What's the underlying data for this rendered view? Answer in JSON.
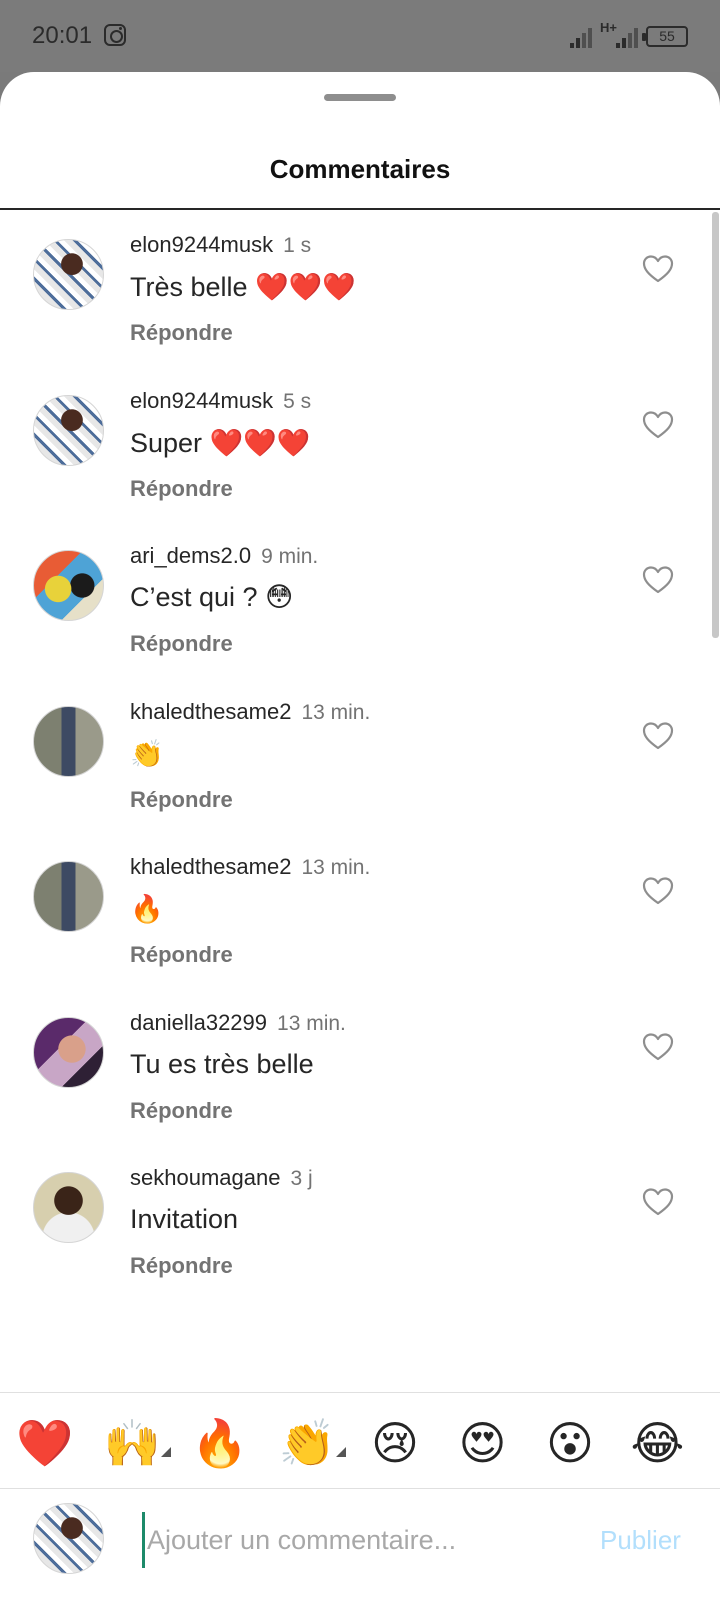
{
  "status_bar": {
    "time": "20:01",
    "network": "H+",
    "battery": "55"
  },
  "sheet": {
    "title": "Commentaires"
  },
  "comments": [
    {
      "user": "elon9244musk",
      "time": "1 s",
      "text": "Très belle ❤️❤️❤️",
      "reply": "Répondre",
      "avatar": "avatar-a"
    },
    {
      "user": "elon9244musk",
      "time": "5 s",
      "text": "Super ❤️❤️❤️",
      "reply": "Répondre",
      "avatar": "avatar-a"
    },
    {
      "user": "ari_dems2.0",
      "time": "9 min.",
      "text": "C’est qui ? 😳",
      "reply": "Répondre",
      "avatar": "avatar-b"
    },
    {
      "user": "khaledthesame2",
      "time": "13 min.",
      "text": "👏",
      "reply": "Répondre",
      "avatar": "avatar-c"
    },
    {
      "user": "khaledthesame2",
      "time": "13 min.",
      "text": "🔥",
      "reply": "Répondre",
      "avatar": "avatar-c"
    },
    {
      "user": "daniella32299",
      "time": "13 min.",
      "text": "Tu es très belle",
      "reply": "Répondre",
      "avatar": "avatar-d"
    },
    {
      "user": "sekhoumagane",
      "time": "3 j",
      "text": "Invitation",
      "reply": "Répondre",
      "avatar": "avatar-e"
    }
  ],
  "reactions": [
    {
      "emoji": "❤️",
      "icon": "heart-emoji",
      "has_more": false
    },
    {
      "emoji": "🙌",
      "icon": "raising-hands-emoji",
      "has_more": true
    },
    {
      "emoji": "🔥",
      "icon": "fire-emoji",
      "has_more": false
    },
    {
      "emoji": "👏",
      "icon": "clapping-hands-emoji",
      "has_more": true
    },
    {
      "emoji": "😢",
      "icon": "crying-face-emoji",
      "has_more": false
    },
    {
      "emoji": "😍",
      "icon": "heart-eyes-emoji",
      "has_more": false
    },
    {
      "emoji": "😮",
      "icon": "surprised-face-emoji",
      "has_more": false
    },
    {
      "emoji": "😂",
      "icon": "tears-of-joy-emoji",
      "has_more": false
    }
  ],
  "composer": {
    "placeholder": "Ajouter un commentaire...",
    "value": "",
    "publish_label": "Publier"
  },
  "colors": {
    "text": "#262626",
    "secondary": "#737373",
    "publish_disabled": "#b2dffc",
    "status_bar_bg": "#7b7b7b"
  }
}
